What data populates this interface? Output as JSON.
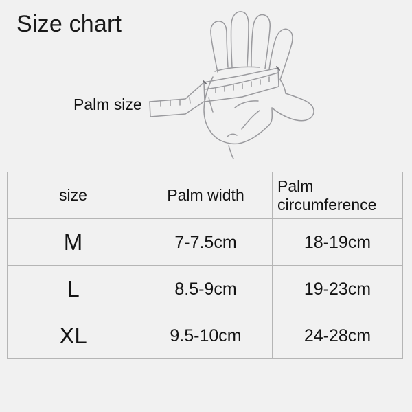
{
  "title": "Size chart",
  "illustration": {
    "label": "Palm size",
    "icon": "hand-palm-with-measuring-tape-icon",
    "stroke_color": "#9a9a9e",
    "background": "#f1f1f1"
  },
  "table": {
    "headers": [
      "size",
      "Palm width",
      "Palm circumference"
    ],
    "rows": [
      {
        "size": "M",
        "palm_width": "7-7.5cm",
        "palm_circumference": "18-19cm"
      },
      {
        "size": "L",
        "palm_width": "8.5-9cm",
        "palm_circumference": "19-23cm"
      },
      {
        "size": "XL",
        "palm_width": "9.5-10cm",
        "palm_circumference": "24-28cm"
      }
    ],
    "border_color": "#b5b5b5"
  },
  "colors": {
    "background": "#f1f1f1",
    "text": "#141414",
    "line_art": "#9a9a9e"
  }
}
